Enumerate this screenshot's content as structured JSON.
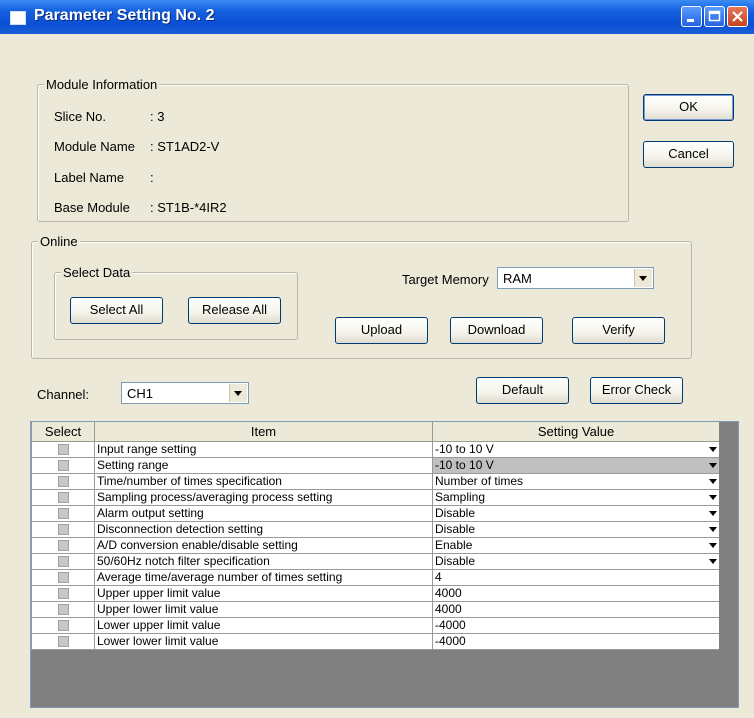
{
  "window": {
    "title": "Parameter Setting No. 2"
  },
  "module_info": {
    "legend": "Module Information",
    "slice_label": "Slice No.",
    "slice_value": ":  3",
    "module_name_label": "Module Name",
    "module_name_value": ":  ST1AD2-V",
    "label_name_label": "Label Name",
    "label_name_value": ":",
    "base_module_label": "Base Module",
    "base_module_value": ":  ST1B-*4IR2"
  },
  "buttons": {
    "ok": "OK",
    "cancel": "Cancel",
    "select_all": "Select All",
    "release_all": "Release All",
    "upload": "Upload",
    "download": "Download",
    "verify": "Verify",
    "default": "Default",
    "error_check": "Error Check"
  },
  "online": {
    "legend": "Online",
    "select_data_legend": "Select Data",
    "target_memory_label": "Target Memory",
    "target_memory_value": "RAM"
  },
  "channel": {
    "label": "Channel:",
    "value": "CH1"
  },
  "table": {
    "headers": {
      "select": "Select",
      "item": "Item",
      "value": "Setting Value"
    },
    "rows": [
      {
        "item": "Input range setting",
        "value": "-10 to 10 V",
        "dropdown": true
      },
      {
        "item": "Setting range",
        "value": "-10 to 10 V",
        "dropdown": true
      },
      {
        "item": "Time/number of times specification",
        "value": "Number of times",
        "dropdown": true
      },
      {
        "item": "Sampling process/averaging process setting",
        "value": "Sampling",
        "dropdown": true
      },
      {
        "item": "Alarm output setting",
        "value": "Disable",
        "dropdown": true
      },
      {
        "item": "Disconnection detection setting",
        "value": "Disable",
        "dropdown": true
      },
      {
        "item": "A/D conversion enable/disable setting",
        "value": "Enable",
        "dropdown": true
      },
      {
        "item": "50/60Hz notch filter specification",
        "value": "Disable",
        "dropdown": true
      },
      {
        "item": "Average time/average number of times setting",
        "value": "4",
        "dropdown": false
      },
      {
        "item": "Upper upper limit value",
        "value": "4000",
        "dropdown": false
      },
      {
        "item": "Upper lower limit value",
        "value": "4000",
        "dropdown": false
      },
      {
        "item": "Lower upper limit value",
        "value": "-4000",
        "dropdown": false
      },
      {
        "item": "Lower lower limit value",
        "value": "-4000",
        "dropdown": false
      }
    ]
  }
}
